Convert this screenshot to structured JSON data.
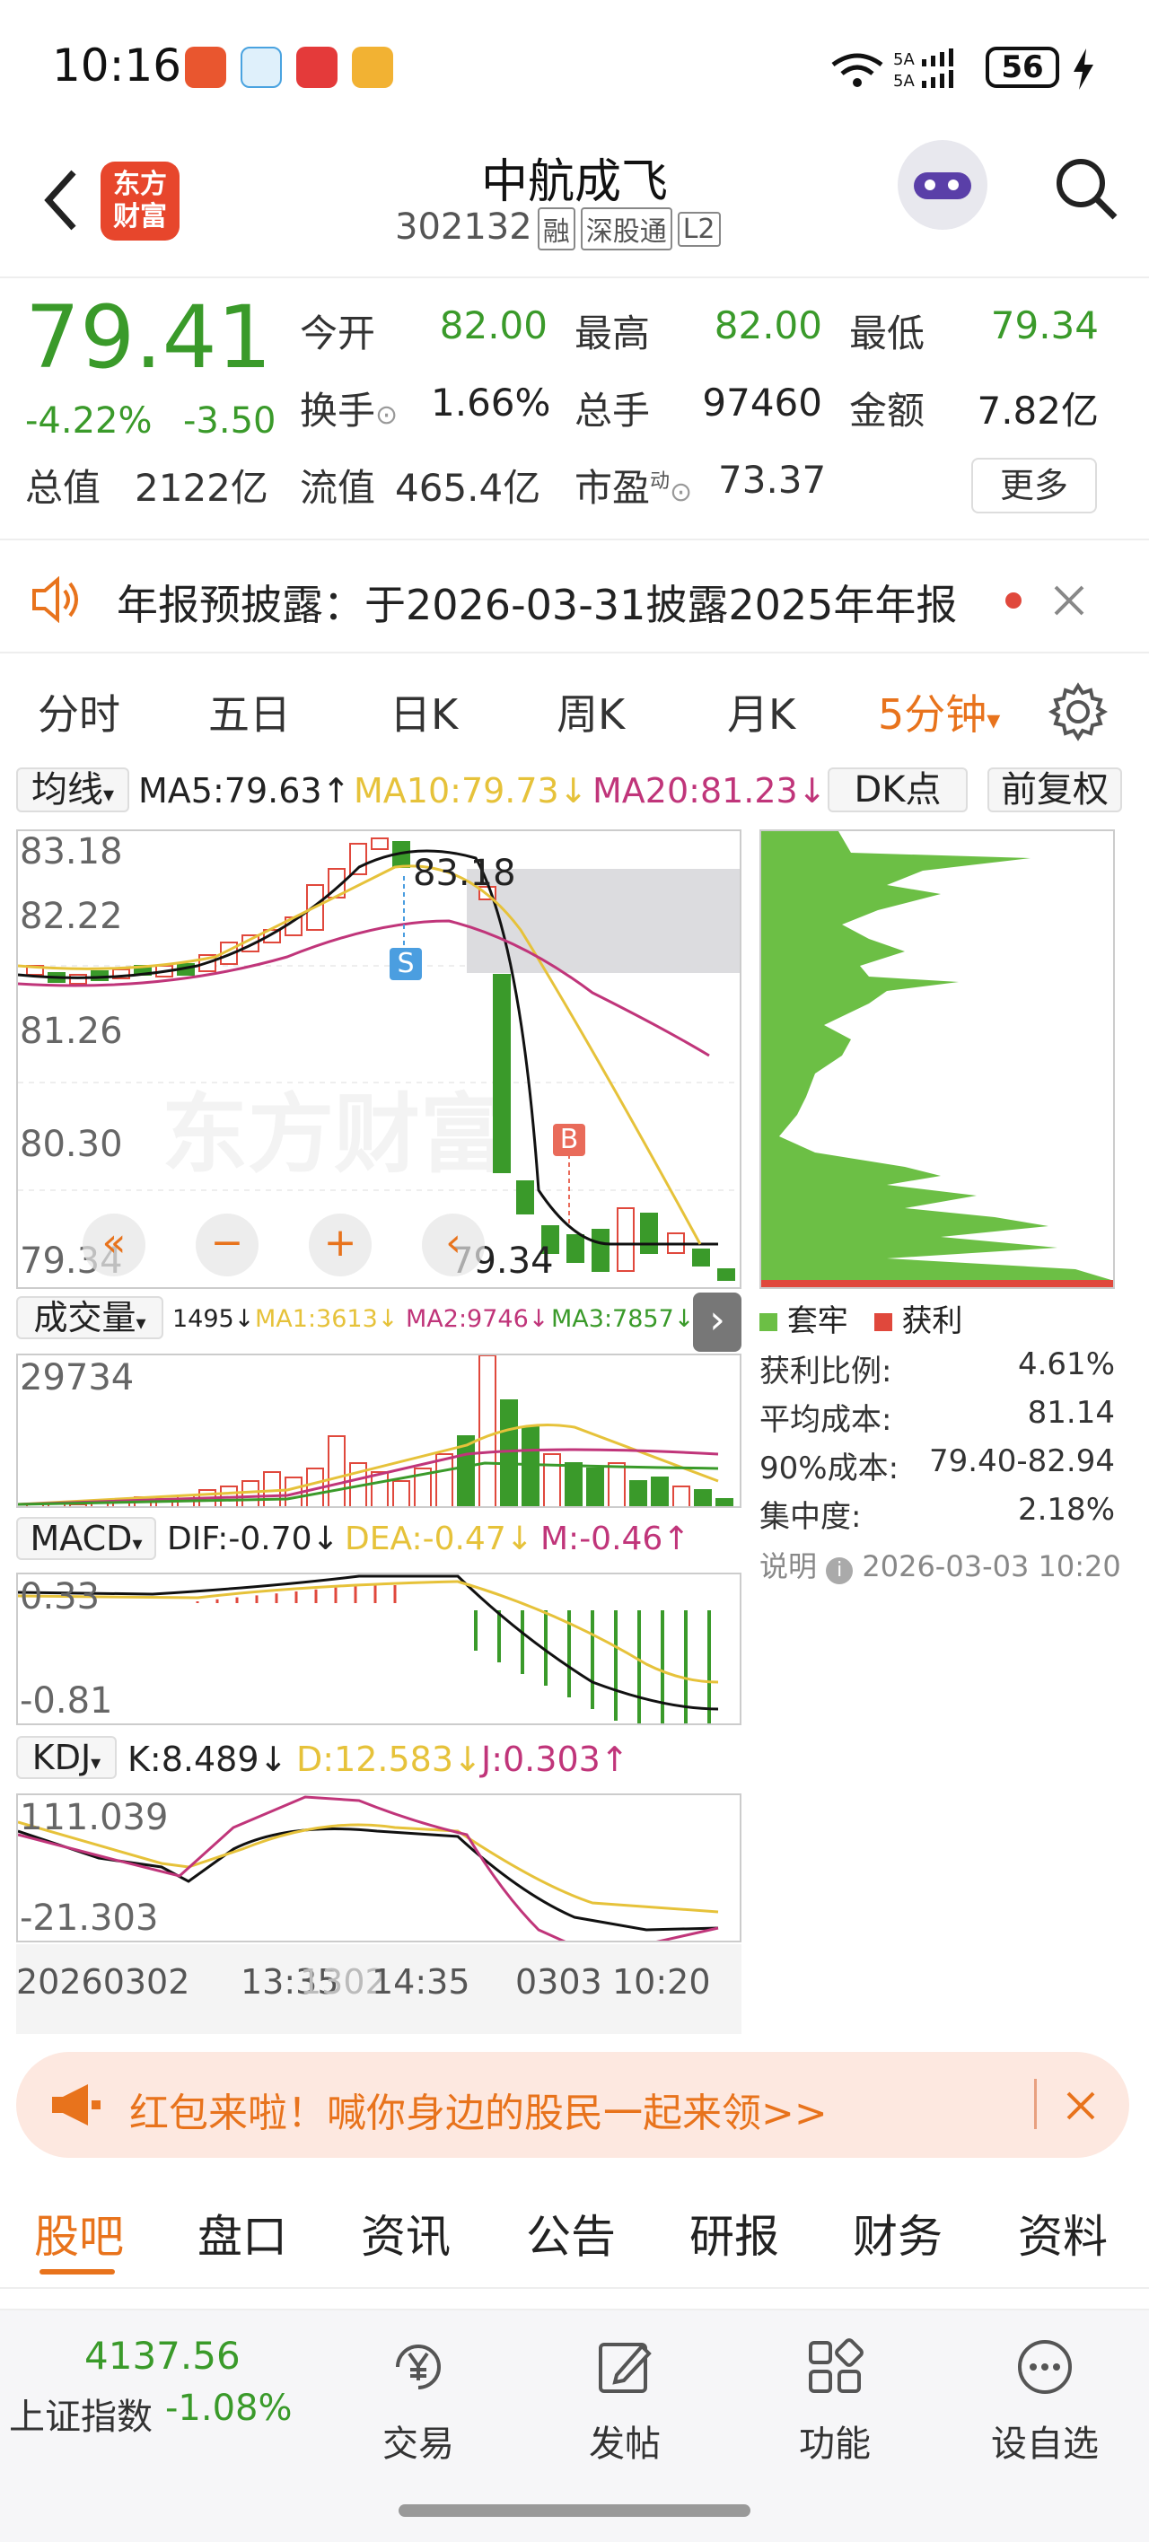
{
  "status": {
    "time": "10:16",
    "battery": "56"
  },
  "header": {
    "logo_text": "东方\n财富",
    "name": "中航成飞",
    "code": "302132",
    "tags": [
      "融",
      "深股通",
      "L2"
    ]
  },
  "quote": {
    "price": "79.41",
    "change_pct": "-4.22%",
    "change": "-3.50",
    "labels": {
      "open": "今开",
      "high": "最高",
      "low": "最低",
      "turnover": "换手",
      "volume": "总手",
      "amount": "金额",
      "mcap": "总值",
      "float": "流值",
      "pe": "市盈"
    },
    "values": {
      "open": "82.00",
      "high": "82.00",
      "low": "79.34",
      "turnover": "1.66%",
      "volume": "97460",
      "amount": "7.82亿",
      "mcap": "2122亿",
      "float": "465.4亿",
      "pe": "73.37"
    },
    "pe_sup": "动",
    "more": "更多"
  },
  "notice": {
    "text": "年报预披露：于2026-03-31披露2025年年报"
  },
  "tabs": [
    "分时",
    "五日",
    "日K",
    "周K",
    "月K",
    "5分钟"
  ],
  "tab_active": "5分钟",
  "ma": {
    "selector": "均线",
    "ma5": "MA5:79.63↑",
    "ma10": "MA10:79.73↓",
    "ma20": "MA20:81.23↓",
    "dk": "DK点",
    "adj": "前复权"
  },
  "price_chart": {
    "ylabels": [
      "83.18",
      "82.22",
      "81.26",
      "80.30",
      "79.34"
    ],
    "hi_label": "83.18",
    "lo_label": "79.34",
    "watermark": "东方财富",
    "s_mark": "S",
    "b_mark": "B"
  },
  "volume": {
    "selector": "成交量",
    "v": "1495↓",
    "ma1": "MA1:3613↓",
    "ma2": "MA2:9746↓",
    "ma3": "MA3:7857↓",
    "ymax": "29734"
  },
  "macd": {
    "selector": "MACD",
    "dif": "DIF:-0.70↓",
    "dea": "DEA:-0.47↓",
    "m": "M:-0.46↑",
    "ytop": "0.33",
    "ybot": "-0.81"
  },
  "kdj": {
    "selector": "KDJ",
    "k": "K:8.489↓",
    "d": "D:12.583↓",
    "j": "J:0.303↑",
    "ytop": "111.039",
    "ybot": "-21.303"
  },
  "xaxis": [
    "20260302",
    "13:35",
    "1302",
    "14:35",
    "0303",
    "10:20"
  ],
  "chips": {
    "legend_trap": "套牢",
    "legend_profit": "获利",
    "rows": [
      {
        "label": "获利比例:",
        "value": "4.61%"
      },
      {
        "label": "平均成本:",
        "value": "81.14"
      },
      {
        "label": "90%成本:",
        "value": "79.40-82.94"
      },
      {
        "label": "集中度:",
        "value": "2.18%"
      }
    ],
    "note_label": "说明",
    "note_time": "2026-03-03 10:20"
  },
  "banner": {
    "text": "红包来啦！喊你身边的股民一起来领>>"
  },
  "bottom_tabs": [
    "股吧",
    "盘口",
    "资讯",
    "公告",
    "研报",
    "财务",
    "资料"
  ],
  "index": {
    "value": "4137.56",
    "name": "上证指数",
    "pct": "-1.08%"
  },
  "nav": [
    "交易",
    "发帖",
    "功能",
    "设自选"
  ],
  "colors": {
    "up": "#e0483c",
    "down": "#3a9a2a",
    "ma10": "#e6c23a",
    "ma20": "#c0357a",
    "accent": "#e8731c"
  }
}
